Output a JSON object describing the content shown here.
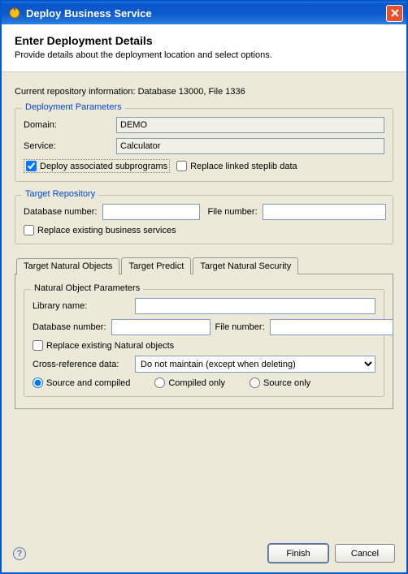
{
  "window": {
    "title": "Deploy Business Service"
  },
  "header": {
    "title": "Enter Deployment Details",
    "subtitle": "Provide details about the deployment location and select options."
  },
  "repo_info": "Current repository information: Database 13000, File 1336",
  "deployment": {
    "legend": "Deployment Parameters",
    "domain_label": "Domain:",
    "domain_value": "DEMO",
    "service_label": "Service:",
    "service_value": "Calculator",
    "deploy_sub_label": "Deploy associated subprograms",
    "deploy_sub_checked": true,
    "replace_steplib_label": "Replace linked steplib data",
    "replace_steplib_checked": false
  },
  "target_repo": {
    "legend": "Target Repository",
    "db_label": "Database number:",
    "db_value": "",
    "file_label": "File number:",
    "file_value": "",
    "replace_label": "Replace existing business services",
    "replace_checked": false
  },
  "tabs": {
    "items": [
      "Target Natural Objects",
      "Target Predict",
      "Target Natural Security"
    ],
    "active": 0
  },
  "natural_objects": {
    "legend": "Natural Object Parameters",
    "lib_label": "Library name:",
    "lib_value": "",
    "db_label": "Database number:",
    "db_value": "",
    "file_label": "File number:",
    "file_value": "",
    "replace_label": "Replace existing Natural objects",
    "replace_checked": false,
    "cross_label": "Cross-reference data:",
    "cross_value": "Do not maintain (except when deleting)",
    "radio_source_compiled": "Source and compiled",
    "radio_compiled": "Compiled only",
    "radio_source": "Source only",
    "radio_selected": "source_compiled"
  },
  "footer": {
    "finish": "Finish",
    "cancel": "Cancel"
  }
}
